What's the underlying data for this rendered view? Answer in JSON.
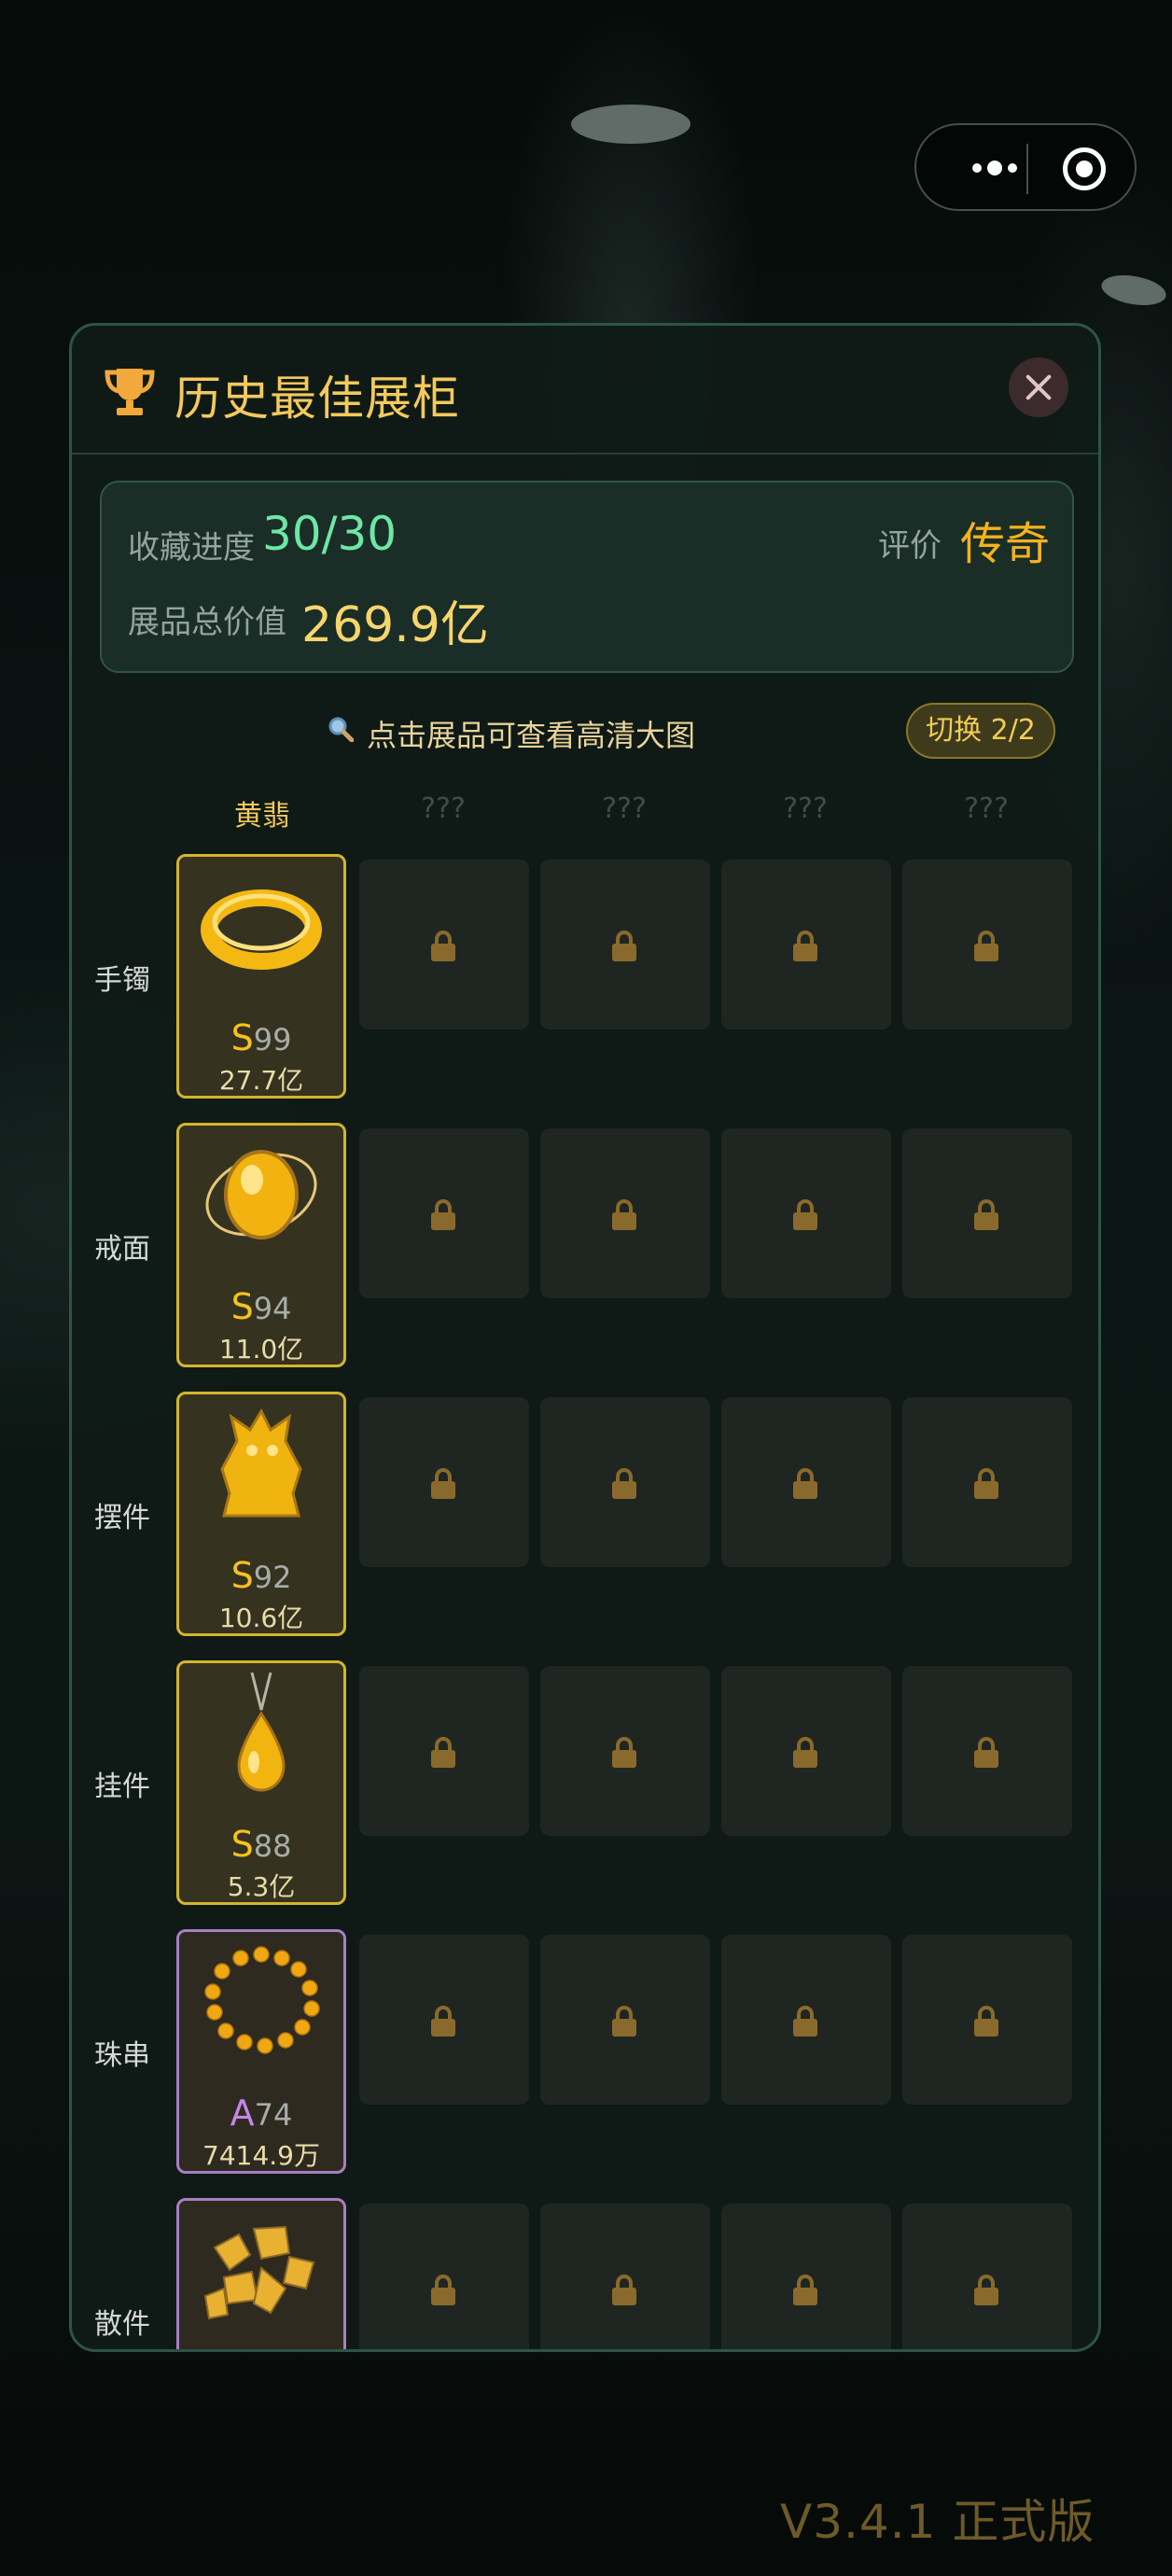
{
  "version_text": "V3.4.1 正式版",
  "panel": {
    "title": "历史最佳展柜",
    "stats": {
      "progress_label": "收藏进度",
      "progress_value": "30/30",
      "rating_label": "评价",
      "rating_value": "传奇",
      "total_label": "展品总价值",
      "total_value": "269.9亿"
    },
    "hint": "点击展品可查看高清大图",
    "switch_label": "切换 2/2",
    "columns": [
      "黄翡",
      "???",
      "???",
      "???",
      "???"
    ],
    "rows": [
      {
        "label": "手镯",
        "grade": "S",
        "score": "99",
        "value": "27.7亿"
      },
      {
        "label": "戒面",
        "grade": "S",
        "score": "94",
        "value": "11.0亿"
      },
      {
        "label": "摆件",
        "grade": "S",
        "score": "92",
        "value": "10.6亿"
      },
      {
        "label": "挂件",
        "grade": "S",
        "score": "88",
        "value": "5.3亿"
      },
      {
        "label": "珠串",
        "grade": "A",
        "score": "74",
        "value": "7414.9万"
      },
      {
        "label": "散件",
        "grade": "",
        "score": "",
        "value": ""
      }
    ]
  },
  "colors": {
    "accent_gold": "#f4c95d",
    "progress_green": "#6ee6a4",
    "rating_orange": "#f4b21e",
    "grade_s": "#f7c21c",
    "grade_a": "#c487e6"
  },
  "icons": {
    "title": "trophy-icon",
    "close": "close-icon",
    "hint": "search-icon",
    "locked": "lock-icon"
  }
}
